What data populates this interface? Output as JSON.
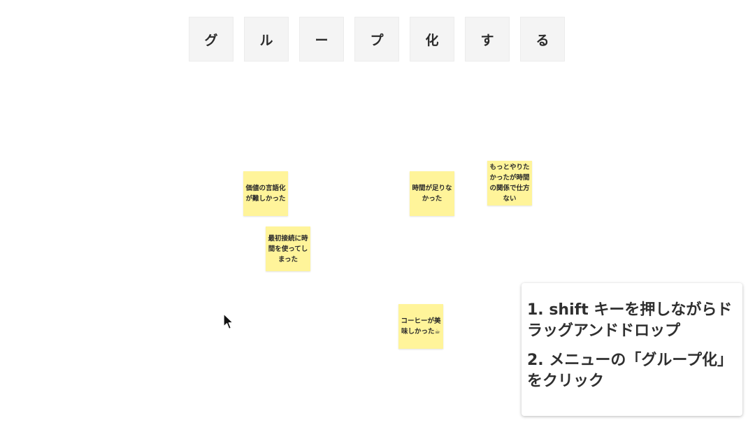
{
  "title_tiles": [
    "グ",
    "ル",
    "ー",
    "プ",
    "化",
    "す",
    "る"
  ],
  "stickies": [
    {
      "text": "価値の言語化が難しかった"
    },
    {
      "text": "時間が足りなかった"
    },
    {
      "text": "もっとやりたかったが時間の関係で仕方ない"
    },
    {
      "text": "最初接続に時間を使ってしまった"
    },
    {
      "text": "コーヒーが美味しかった☕"
    }
  ],
  "instructions": {
    "step1": "1. shift キーを押しながらドラッグアンドドロップ",
    "step2": "2. メニューの「グループ化」をクリック"
  },
  "colors": {
    "sticky": "#fff49a",
    "tile": "#f4f4f4",
    "text": "#2b2b2b"
  },
  "cursor_icon": "mouse-pointer-icon"
}
